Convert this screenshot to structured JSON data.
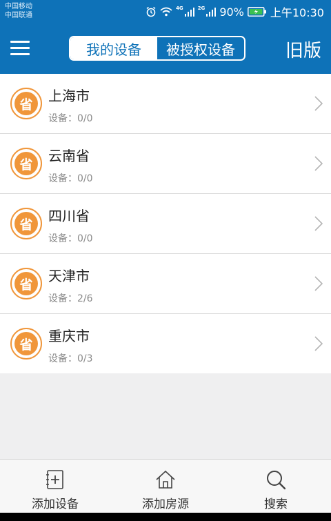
{
  "status_bar": {
    "carrier1": "中国移动",
    "carrier2": "中国联通",
    "net1": "4G",
    "net2": "2G",
    "battery": "90%",
    "time": "上午10:30"
  },
  "header": {
    "tabs": [
      {
        "label": "我的设备",
        "active": true
      },
      {
        "label": "被授权设备",
        "active": false
      }
    ],
    "old_version_label": "旧版"
  },
  "list": {
    "badge_label": "省",
    "items": [
      {
        "name": "上海市",
        "devices": "设备：0/0"
      },
      {
        "name": "云南省",
        "devices": "设备：0/0"
      },
      {
        "name": "四川省",
        "devices": "设备：0/0"
      },
      {
        "name": "天津市",
        "devices": "设备：2/6"
      },
      {
        "name": "重庆市",
        "devices": "设备：0/3"
      }
    ]
  },
  "bottom_nav": {
    "items": [
      {
        "label": "添加设备",
        "icon": "add-device-icon"
      },
      {
        "label": "添加房源",
        "icon": "house-icon"
      },
      {
        "label": "搜索",
        "icon": "search-icon"
      }
    ]
  },
  "colors": {
    "brand_blue": "#0e72b8",
    "badge_orange": "#f0963a"
  }
}
